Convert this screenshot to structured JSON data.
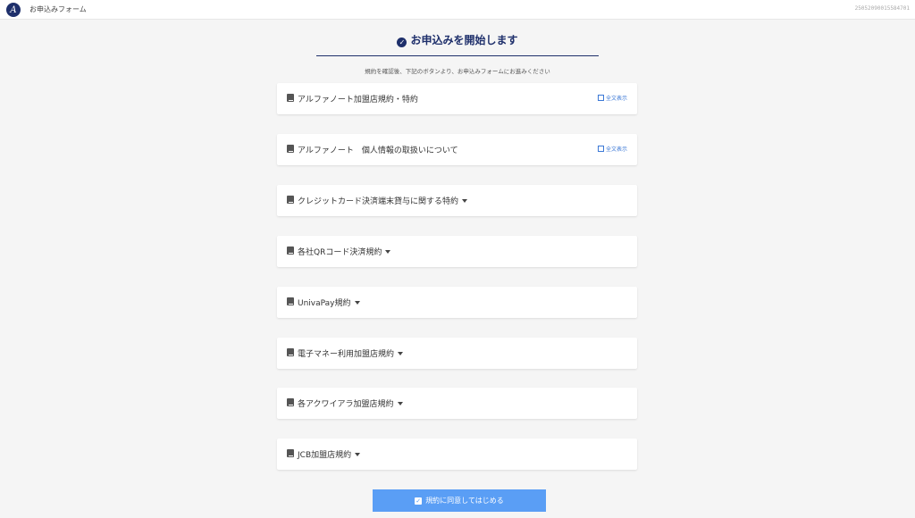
{
  "header": {
    "logo_letter": "A",
    "app_title": "お申込みフォーム",
    "session_id": "25052090015584701"
  },
  "main": {
    "heading": "お申込みを開始します",
    "instruction": "規約を確認後、下記のボタンより、お申込みフォームにお進みください",
    "terms": [
      {
        "label": "アルファノート加盟店規約・特約",
        "link_label": "全文表示"
      },
      {
        "label": "アルファノート　個人情報の取扱いについて",
        "link_label": "全文表示"
      },
      {
        "label": "クレジットカード決済端末貸与に関する特約"
      },
      {
        "label": "各社QRコード決済規約"
      },
      {
        "label": "UnivaPay規約"
      },
      {
        "label": "電子マネー利用加盟店規約"
      },
      {
        "label": "各アクワイアラ加盟店規約"
      },
      {
        "label": "JCB加盟店規約"
      }
    ],
    "submit_label": "規約に同意してはじめる"
  },
  "colors": {
    "brand": "#1e2f6b",
    "link": "#3b78d6",
    "button": "#5a9ef5",
    "background": "#f5f5f5"
  }
}
